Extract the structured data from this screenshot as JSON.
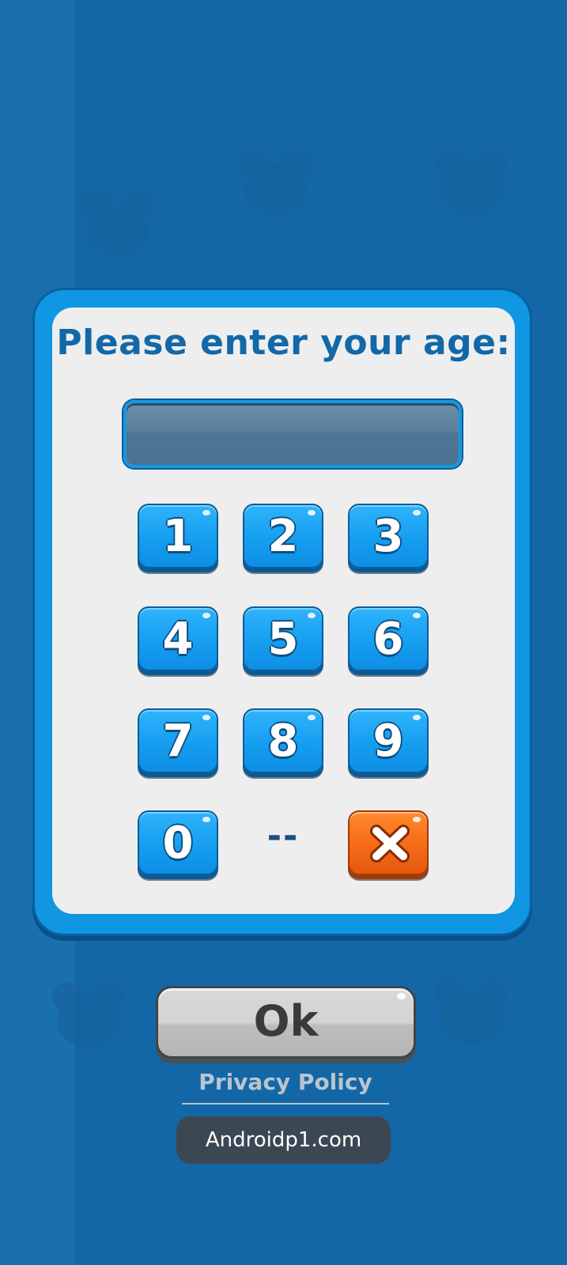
{
  "dialog": {
    "prompt": "Please enter your age:",
    "age_value": ""
  },
  "keypad": {
    "keys": [
      "1",
      "2",
      "3",
      "4",
      "5",
      "6",
      "7",
      "8",
      "9",
      "0"
    ],
    "separator": "--",
    "clear_icon": "x-icon"
  },
  "ok_button": {
    "label": "Ok"
  },
  "privacy_link": {
    "label": "Privacy Policy"
  },
  "watermark": {
    "text": "Androidp1.com"
  },
  "colors": {
    "background": "#1467a6",
    "dialog_border": "#1096e2",
    "prompt_text": "#1268a8",
    "key_blue": "#159ef0",
    "key_clear_orange": "#f46a17",
    "ok_button_gray": "#d3d3d3"
  }
}
